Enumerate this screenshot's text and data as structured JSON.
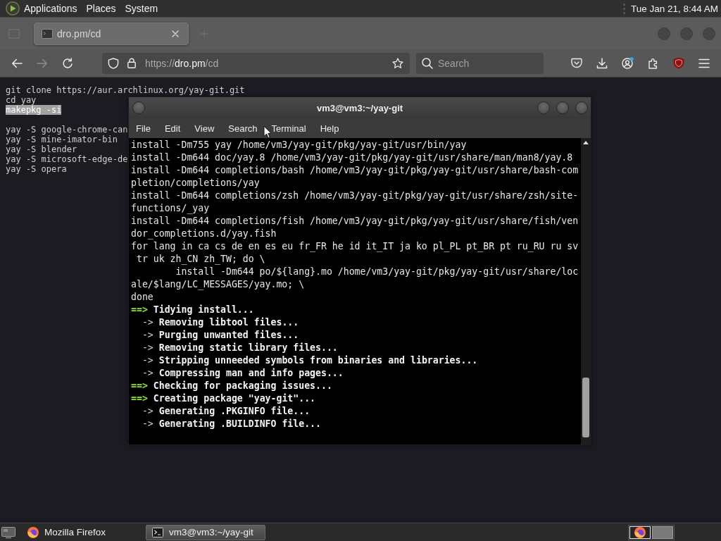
{
  "top_panel": {
    "menus": [
      "Applications",
      "Places",
      "System"
    ],
    "clock": "Tue Jan 21, 8:44 AM"
  },
  "browser": {
    "tabs": [
      {
        "title": "dro.pm/cd",
        "selected": true
      }
    ],
    "toolbar": {
      "forward_disabled": true,
      "url": {
        "scheme": "https://",
        "host": "dro.pm",
        "path": "/cd"
      },
      "search": {
        "placeholder": "Search"
      }
    },
    "page": {
      "blocks": [
        {
          "lines": [
            {
              "text": "git clone https://aur.archlinux.org/yay-git.git",
              "selected": false
            },
            {
              "text": "cd yay",
              "selected": false
            },
            {
              "text": "makepkg -si",
              "selected": true
            }
          ]
        },
        {
          "lines": [
            {
              "text": "yay -S google-chrome-can",
              "selected": false
            },
            {
              "text": "yay -S mine-imator-bin",
              "selected": false
            },
            {
              "text": "yay -S blender",
              "selected": false
            },
            {
              "text": "yay -S microsoft-edge-de",
              "selected": false
            },
            {
              "text": "yay -S opera",
              "selected": false
            }
          ]
        }
      ]
    }
  },
  "terminal": {
    "title": "vm3@vm3:~/yay-git",
    "menus": [
      "File",
      "Edit",
      "View",
      "Search",
      "Terminal",
      "Help"
    ],
    "lines": [
      {
        "kind": "plain",
        "text": "install -Dm755 yay /home/vm3/yay-git/pkg/yay-git/usr/bin/yay"
      },
      {
        "kind": "plain",
        "text": "install -Dm644 doc/yay.8 /home/vm3/yay-git/pkg/yay-git/usr/share/man/man8/yay.8"
      },
      {
        "kind": "plain",
        "text": "install -Dm644 completions/bash /home/vm3/yay-git/pkg/yay-git/usr/share/bash-com"
      },
      {
        "kind": "plain",
        "text": "pletion/completions/yay"
      },
      {
        "kind": "plain",
        "text": "install -Dm644 completions/zsh /home/vm3/yay-git/pkg/yay-git/usr/share/zsh/site-"
      },
      {
        "kind": "plain",
        "text": "functions/_yay"
      },
      {
        "kind": "plain",
        "text": "install -Dm644 completions/fish /home/vm3/yay-git/pkg/yay-git/usr/share/fish/ven"
      },
      {
        "kind": "plain",
        "text": "dor_completions.d/yay.fish"
      },
      {
        "kind": "plain",
        "text": "for lang in ca cs de en es eu fr_FR he id it_IT ja ko pl_PL pt_BR pt ru_RU ru sv"
      },
      {
        "kind": "plain",
        "text": " tr uk zh_CN zh_TW; do \\"
      },
      {
        "kind": "plain",
        "text": "        install -Dm644 po/${lang}.mo /home/vm3/yay-git/pkg/yay-git/usr/share/loc"
      },
      {
        "kind": "plain",
        "text": "ale/$lang/LC_MESSAGES/yay.mo; \\"
      },
      {
        "kind": "plain",
        "text": "done"
      },
      {
        "kind": "stage",
        "marker": "==>",
        "text": "Tidying install..."
      },
      {
        "kind": "step",
        "marker": "->",
        "text": "Removing libtool files..."
      },
      {
        "kind": "step",
        "marker": "->",
        "text": "Purging unwanted files..."
      },
      {
        "kind": "step",
        "marker": "->",
        "text": "Removing static library files..."
      },
      {
        "kind": "step",
        "marker": "->",
        "text": "Stripping unneeded symbols from binaries and libraries..."
      },
      {
        "kind": "step",
        "marker": "->",
        "text": "Compressing man and info pages..."
      },
      {
        "kind": "stage",
        "marker": "==>",
        "text": "Checking for packaging issues..."
      },
      {
        "kind": "stage",
        "marker": "==>",
        "text": "Creating package \"yay-git\"..."
      },
      {
        "kind": "step",
        "marker": "->",
        "text": "Generating .PKGINFO file..."
      },
      {
        "kind": "step",
        "marker": "->",
        "text": "Generating .BUILDINFO file..."
      }
    ]
  },
  "taskbar": {
    "tasks": [
      {
        "label": "Mozilla Firefox",
        "selected": false
      },
      {
        "label": "vm3@vm3:~/yay-git",
        "selected": true
      }
    ],
    "workspaces": [
      {
        "selected": true
      },
      {
        "selected": false
      }
    ]
  }
}
